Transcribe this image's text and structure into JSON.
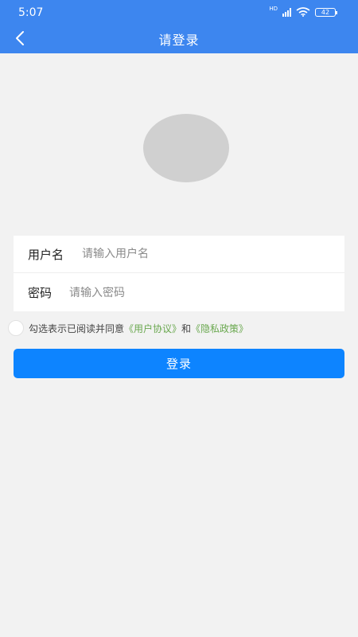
{
  "status_bar": {
    "time": "5:07",
    "network_label": "HD",
    "battery_level": "42"
  },
  "nav": {
    "title": "请登录",
    "back_icon": "chevron-left-icon"
  },
  "form": {
    "username_label": "用户名",
    "username_placeholder": "请输入用户名",
    "username_value": "",
    "password_label": "密码",
    "password_placeholder": "请输入密码",
    "password_value": ""
  },
  "agreement": {
    "checked": false,
    "text": "勾选表示已阅读并同意",
    "user_agreement_link": "《用户协议》",
    "conjunction": "和",
    "privacy_policy_link": "《隐私政策》"
  },
  "login_button_label": "登录",
  "colors": {
    "header_bg": "#3d86ef",
    "button_bg": "#0d84ff",
    "link": "#6aa84f",
    "page_bg": "#f2f2f2",
    "avatar_placeholder": "#d0d0d0"
  }
}
